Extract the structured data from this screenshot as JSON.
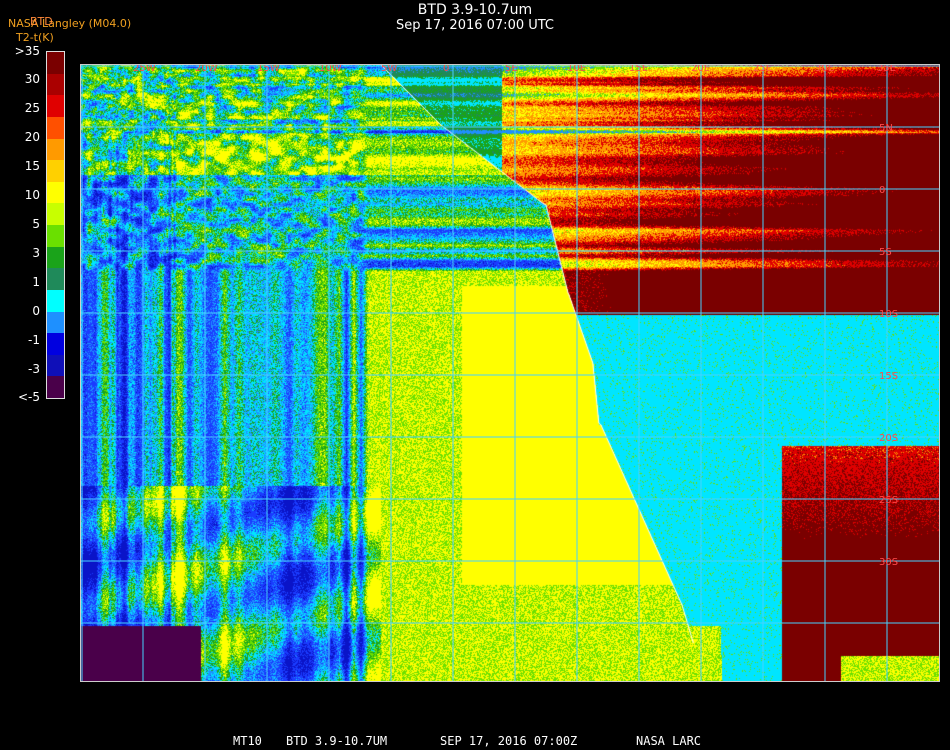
{
  "header": {
    "title": "BTD 3.9-10.7um",
    "subtitle": "Sep 17, 2016 07:00 UTC"
  },
  "credit": {
    "line1": "NASA Langley (M04.0)",
    "line2": "T2-t(K)",
    "unit_overlay": "BTD"
  },
  "legend": {
    "labels": [
      ">35",
      "30",
      "25",
      "20",
      "15",
      "10",
      "5",
      "3",
      "1",
      "0",
      "-1",
      "-3",
      "<-5"
    ],
    "colors": [
      "#7a0000",
      "#aa0000",
      "#e00000",
      "#ff5000",
      "#ff9a00",
      "#ffd000",
      "#ffff00",
      "#c8ff00",
      "#6ae000",
      "#1aa31a",
      "#1f8a5a",
      "#00ffff",
      "#1e90ff",
      "#0000e0",
      "#0f0fb8",
      "#4a004a"
    ]
  },
  "map": {
    "lon_labels": [
      "25W",
      "20W",
      "15W",
      "10W",
      "5W",
      "0",
      "5E",
      "10E",
      "15E",
      "20E",
      "25E",
      "30E",
      "35E"
    ],
    "lat_labels": [
      "5N",
      "0",
      "5S",
      "10S",
      "15S",
      "20S",
      "25S",
      "30S"
    ],
    "palette": {
      "deep_blue": "#0a14c8",
      "blue": "#1a3cff",
      "light_blue": "#1e90ff",
      "cyan": "#00e5ff",
      "teal": "#1f8a5a",
      "green": "#1aa31a",
      "lime": "#6ae000",
      "yellow": "#ffff00",
      "orange": "#ff9a00",
      "red": "#e00000",
      "dark_red": "#7a0000",
      "purple": "#4a004a"
    },
    "grid_color": "#46d2ff",
    "coast_color": "#ffffff",
    "label_color": "#ff4a4a"
  },
  "footer": {
    "sat": "MT10",
    "product": "BTD 3.9-10.7UM",
    "date": "SEP 17, 2016 07:00Z",
    "org": "NASA LARC"
  }
}
